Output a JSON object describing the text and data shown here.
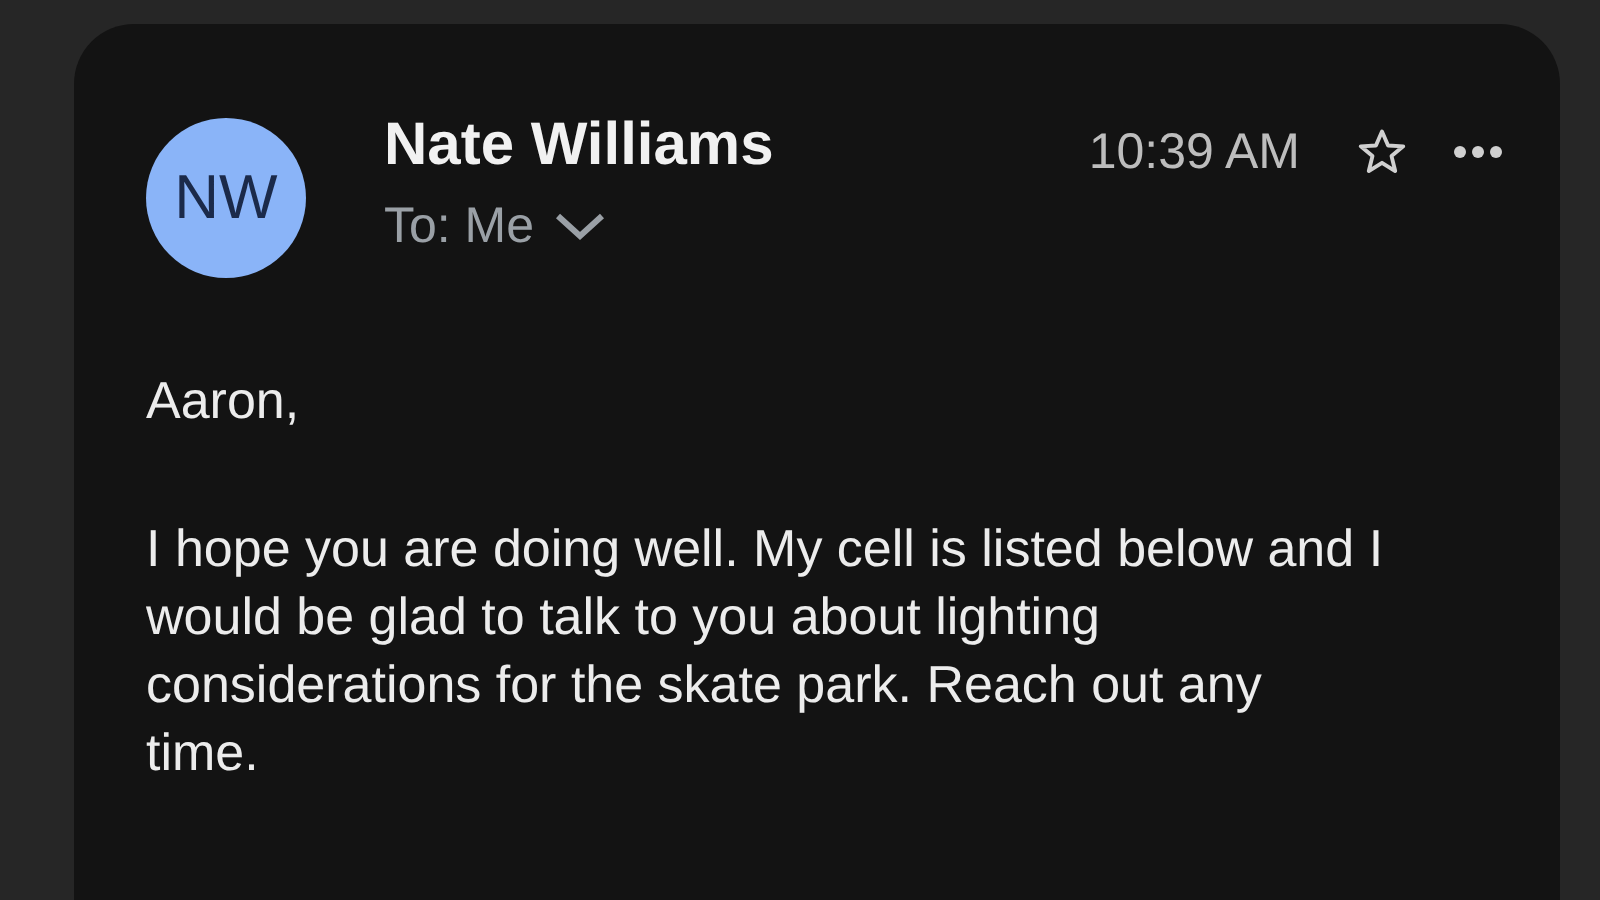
{
  "sender": {
    "initials": "NW",
    "name": "Nate Williams",
    "recipient": "To: Me",
    "time": "10:39 AM",
    "starred": false
  },
  "body": {
    "greeting": "Aaron,",
    "paragraph": "I hope you are doing well. My cell is listed below and I would be glad to talk to you about lighting considerations for the skate park. Reach out any time."
  }
}
